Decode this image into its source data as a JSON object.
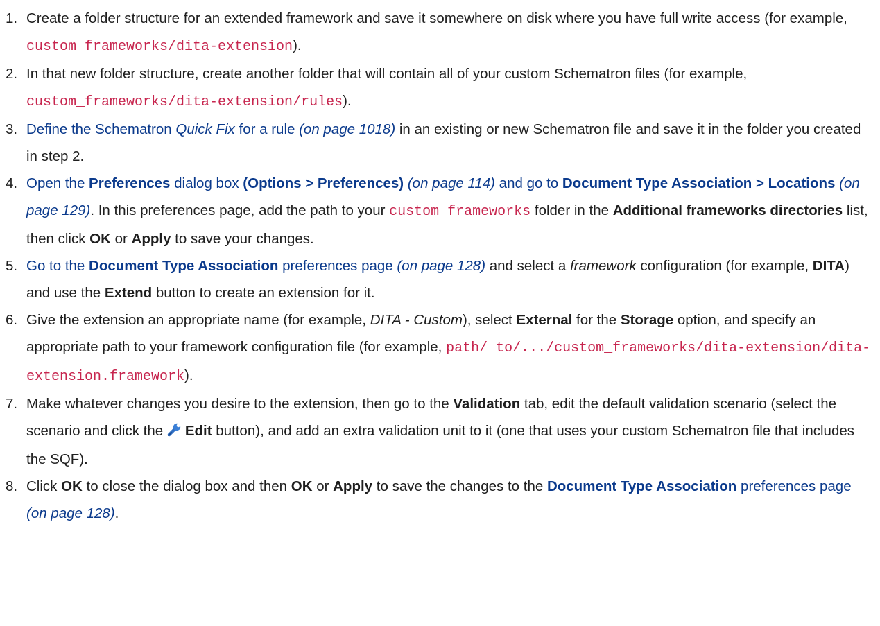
{
  "steps": [
    {
      "n": "1.",
      "parts": [
        {
          "t": "Create a folder structure for an extended framework and save it somewhere on disk where you have full write access (for example, "
        },
        {
          "t": "custom_frameworks/dita-extension",
          "s": "code"
        },
        {
          "t": ")."
        }
      ]
    },
    {
      "n": "2.",
      "parts": [
        {
          "t": "In that new folder structure, create another folder that will contain all of your custom Schematron files (for example, "
        },
        {
          "t": "custom_frameworks/dita-extension/rules",
          "s": "code"
        },
        {
          "t": ")."
        }
      ]
    },
    {
      "n": "3.",
      "parts": [
        {
          "t": "Define the Schematron ",
          "s": "link"
        },
        {
          "t": "Quick Fix",
          "s": "link i"
        },
        {
          "t": " for a rule ",
          "s": "link"
        },
        {
          "t": "(on page 1018)",
          "s": "link i"
        },
        {
          "t": " in an existing or new Schematron file and save it in the folder you created in step 2."
        }
      ]
    },
    {
      "n": "4.",
      "parts": [
        {
          "t": "Open the ",
          "s": "link"
        },
        {
          "t": "Preferences",
          "s": "link b"
        },
        {
          "t": " dialog box ",
          "s": "link"
        },
        {
          "t": "(Options > Preferences)",
          "s": "link b"
        },
        {
          "t": " "
        },
        {
          "t": "(on page 114)",
          "s": "link i"
        },
        {
          "t": " and go to ",
          "s": "link"
        },
        {
          "t": "Document Type Association > Locations",
          "s": "link b"
        },
        {
          "t": " "
        },
        {
          "t": "(on page 129)",
          "s": "link i"
        },
        {
          "t": ". In this preferences page, add the path to your "
        },
        {
          "t": "custom_frameworks",
          "s": "code"
        },
        {
          "t": " folder in the "
        },
        {
          "t": "Additional frameworks directories",
          "s": "b"
        },
        {
          "t": " list, then click "
        },
        {
          "t": "OK",
          "s": "b"
        },
        {
          "t": " or "
        },
        {
          "t": "Apply",
          "s": "b"
        },
        {
          "t": " to save your changes."
        }
      ]
    },
    {
      "n": "5.",
      "parts": [
        {
          "t": "Go to the ",
          "s": "link"
        },
        {
          "t": "Document Type Association",
          "s": "link b"
        },
        {
          "t": " preferences page ",
          "s": "link"
        },
        {
          "t": "(on page 128)",
          "s": "link i"
        },
        {
          "t": " and select a "
        },
        {
          "t": "framework",
          "s": "i"
        },
        {
          "t": " configuration (for example, "
        },
        {
          "t": "DITA",
          "s": "b"
        },
        {
          "t": ") and use the "
        },
        {
          "t": "Extend",
          "s": "b"
        },
        {
          "t": " button to create an extension for it."
        }
      ]
    },
    {
      "n": "6.",
      "parts": [
        {
          "t": "Give the extension an appropriate name (for example, "
        },
        {
          "t": "DITA - Custom",
          "s": "i"
        },
        {
          "t": "), select "
        },
        {
          "t": "External",
          "s": "b"
        },
        {
          "t": " for the "
        },
        {
          "t": "Storage",
          "s": "b"
        },
        {
          "t": " option, and specify an appropriate path to your framework configuration file (for example, "
        },
        {
          "t": "path/ to/.../custom_frameworks/dita-extension/dita-extension.framework",
          "s": "code"
        },
        {
          "t": ")."
        }
      ]
    },
    {
      "n": "7.",
      "parts": [
        {
          "t": "Make whatever changes you desire to the extension, then go to the "
        },
        {
          "t": "Validation",
          "s": "b"
        },
        {
          "t": " tab, edit the default validation scenario (select the scenario and click the "
        },
        {
          "t": "",
          "s": "icon"
        },
        {
          "t": "Edit",
          "s": "b"
        },
        {
          "t": " button), and add an extra validation unit to it (one that uses your custom Schematron file that includes the SQF)."
        }
      ]
    },
    {
      "n": "8.",
      "parts": [
        {
          "t": "Click "
        },
        {
          "t": "OK",
          "s": "b"
        },
        {
          "t": " to close the dialog box and then "
        },
        {
          "t": "OK",
          "s": "b"
        },
        {
          "t": " or "
        },
        {
          "t": "Apply",
          "s": "b"
        },
        {
          "t": " to save the changes to the "
        },
        {
          "t": "Document Type Association",
          "s": "link b"
        },
        {
          "t": " preferences page ",
          "s": "link"
        },
        {
          "t": "(on page 128)",
          "s": "link i"
        },
        {
          "t": "."
        }
      ]
    }
  ],
  "icons": {
    "edit": "wrench-icon"
  },
  "colors": {
    "link": "#0b3a8c",
    "code": "#c7254e",
    "text": "#1f1f1f"
  }
}
